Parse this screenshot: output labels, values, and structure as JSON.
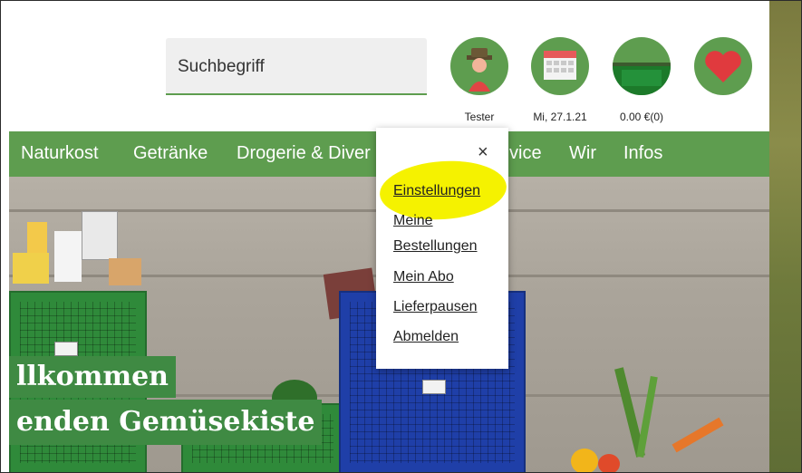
{
  "search": {
    "placeholder": "Suchbegriff"
  },
  "header_icons": [
    {
      "name": "user-icon",
      "label": "Tester"
    },
    {
      "name": "calendar-icon",
      "label": "Mi, 27.1.21"
    },
    {
      "name": "crate-icon",
      "label": "0.00 €(0)"
    },
    {
      "name": "heart-icon",
      "label": ""
    }
  ],
  "nav": [
    "Naturkost",
    "Getränke",
    "Drogerie & Diver",
    "vice",
    "Wir",
    "Infos"
  ],
  "hero": {
    "line1": "llkommen",
    "line2": "enden Gemüsekiste"
  },
  "account_menu": {
    "close": "×",
    "items": [
      "Einstellungen",
      "Meine",
      "Bestellungen",
      "Mein Abo",
      "Lieferpausen",
      "Abmelden"
    ]
  },
  "colors": {
    "brand_green": "#5e9d4f",
    "highlight": "#f5f200",
    "heart": "#e03a3e"
  }
}
